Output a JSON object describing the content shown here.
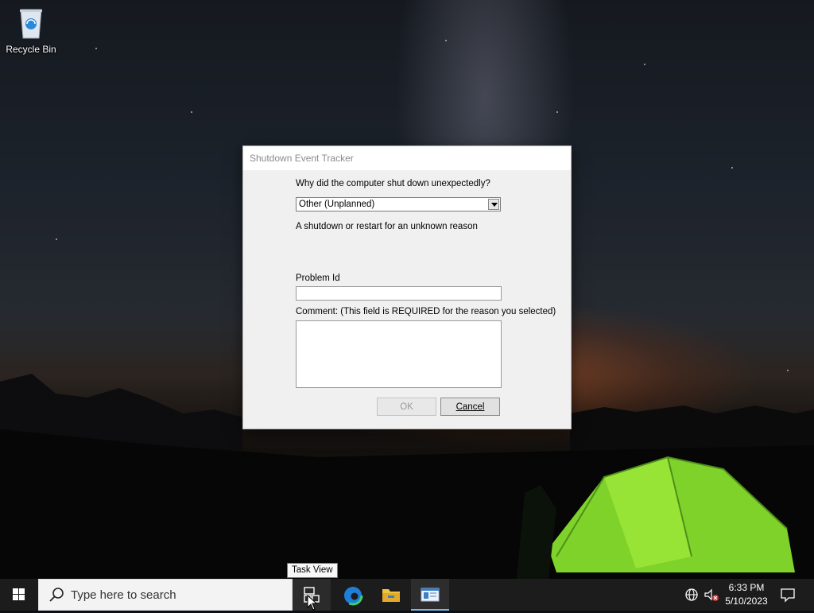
{
  "desktop": {
    "icons": [
      {
        "label": "Recycle Bin",
        "icon": "recycle-bin-icon"
      }
    ]
  },
  "dialog": {
    "title": "Shutdown Event Tracker",
    "question_label": "Why did the computer shut down unexpectedly?",
    "reason_selected": "Other (Unplanned)",
    "reason_description": "A shutdown or restart for an unknown reason",
    "problem_id_label": "Problem Id",
    "problem_id_value": "",
    "comment_label": "Comment: (This field is REQUIRED for the reason you selected)",
    "comment_value": "",
    "ok_label": "OK",
    "ok_enabled": false,
    "cancel_label": "Cancel"
  },
  "tooltip": {
    "text": "Task View"
  },
  "taskbar": {
    "search_placeholder": "Type here to search",
    "pinned": [
      {
        "name": "task-view",
        "icon": "task-view-icon"
      },
      {
        "name": "edge",
        "icon": "edge-icon"
      },
      {
        "name": "file-explorer",
        "icon": "folder-icon"
      },
      {
        "name": "active-app",
        "icon": "window-app-icon",
        "active": true
      }
    ],
    "tray": {
      "time": "6:33 PM",
      "date": "5/10/2023",
      "icons": [
        "network-icon",
        "volume-muted-icon",
        "notification-icon"
      ]
    }
  },
  "colors": {
    "taskbar_bg": "#1c1c1c",
    "accent": "#0078d7",
    "dialog_bg": "#f0f0f0"
  }
}
